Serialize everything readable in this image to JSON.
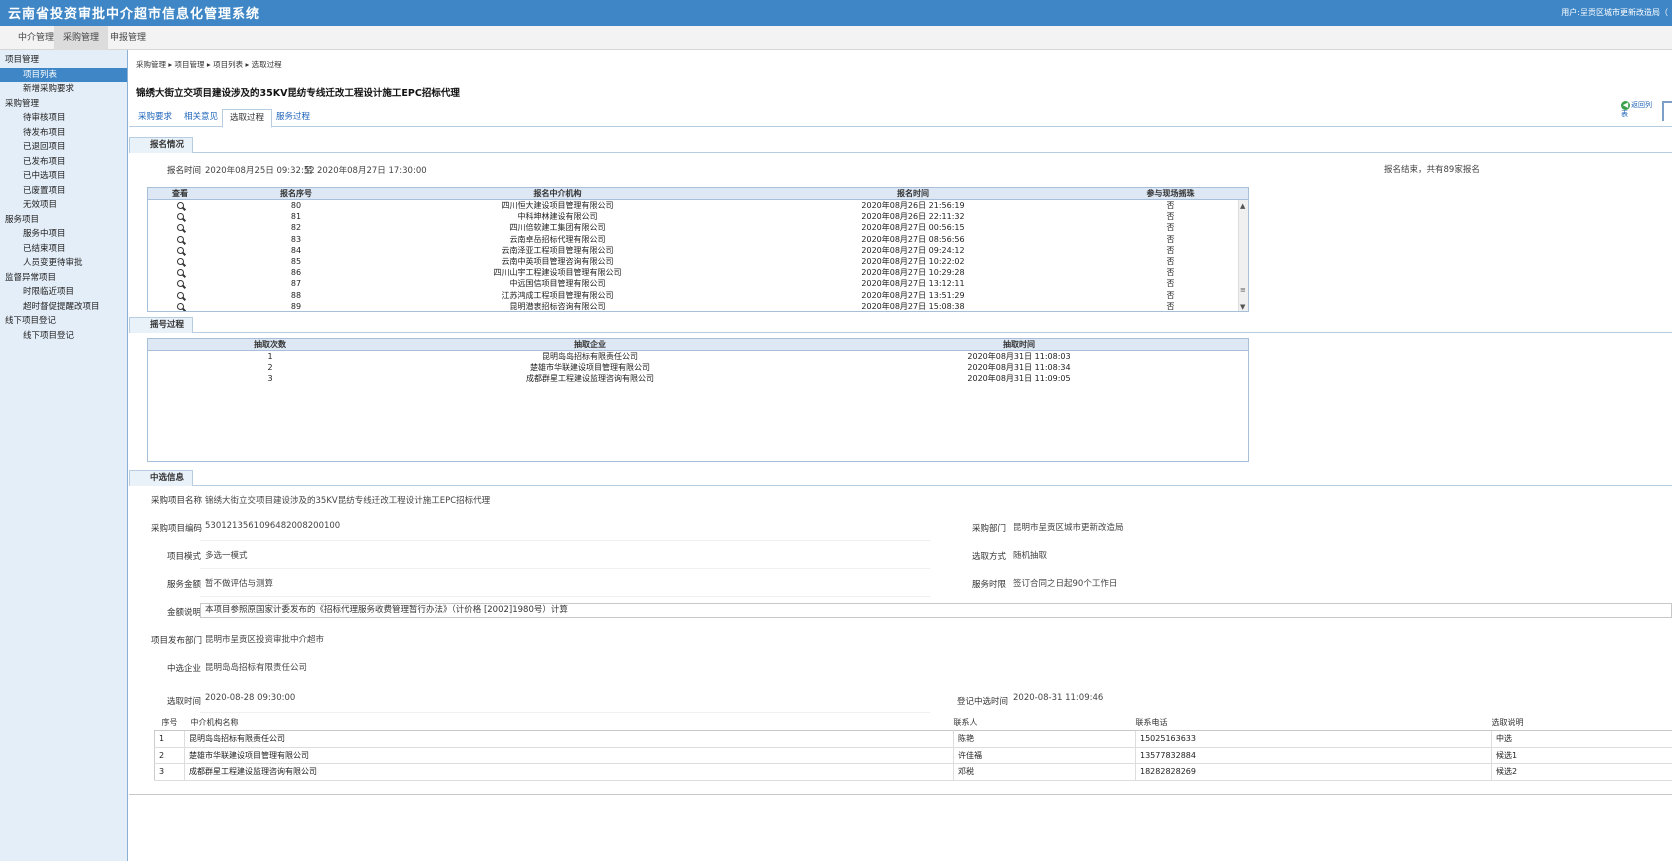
{
  "app": {
    "title": "云南省投资审批中介超市信息化管理系统",
    "user": "用户:呈贡区城市更新改造局（"
  },
  "nav_tabs": [
    {
      "label": "中介管理"
    },
    {
      "label": "采购管理"
    },
    {
      "label": "申报管理"
    }
  ],
  "sidebar": [
    {
      "label": "项目管理",
      "type": "group"
    },
    {
      "label": "项目列表",
      "type": "item",
      "active": true
    },
    {
      "label": "新增采购要求",
      "type": "item"
    },
    {
      "label": "采购管理",
      "type": "group"
    },
    {
      "label": "待审核项目",
      "type": "item"
    },
    {
      "label": "待发布项目",
      "type": "item"
    },
    {
      "label": "已退回项目",
      "type": "item"
    },
    {
      "label": "已发布项目",
      "type": "item"
    },
    {
      "label": "已中选项目",
      "type": "item"
    },
    {
      "label": "已废置项目",
      "type": "item"
    },
    {
      "label": "无效项目",
      "type": "item"
    },
    {
      "label": "服务项目",
      "type": "group"
    },
    {
      "label": "服务中项目",
      "type": "item"
    },
    {
      "label": "已结束项目",
      "type": "item"
    },
    {
      "label": "人员变更待审批",
      "type": "item"
    },
    {
      "label": "监督异常项目",
      "type": "group"
    },
    {
      "label": "时限临近项目",
      "type": "item"
    },
    {
      "label": "超时督促提醒改项目",
      "type": "item"
    },
    {
      "label": "线下项目登记",
      "type": "group"
    },
    {
      "label": "线下项目登记",
      "type": "item"
    }
  ],
  "breadcrumb": "采购管理 ▸ 项目管理 ▸ 项目列表 ▸ 选取过程",
  "page_title": "锦绣大街立交项目建设涉及的35KV昆纺专线迁改工程设计施工EPC招标代理",
  "back_label": "返回列表",
  "tabs": [
    {
      "label": "采购要求"
    },
    {
      "label": "相关意见"
    },
    {
      "label": "选取过程",
      "active": true
    },
    {
      "label": "服务过程"
    }
  ],
  "registration": {
    "section_title": "报名情况",
    "time_label": "报名时间",
    "start": "2020年08月25日 09:32:52",
    "to": "至",
    "end": "2020年08月27日 17:30:00",
    "summary": "报名结束，共有89家报名",
    "headers": [
      "查看",
      "报名序号",
      "报名中介机构",
      "报名时间",
      "参与现场摇珠"
    ],
    "rows": [
      {
        "no": "80",
        "org": "四川恒大建设项目管理有限公司",
        "time": "2020年08月26日 21:56:19",
        "join": "否"
      },
      {
        "no": "81",
        "org": "中科坤林建设有限公司",
        "time": "2020年08月26日 22:11:32",
        "join": "否"
      },
      {
        "no": "82",
        "org": "四川倍软建工集团有限公司",
        "time": "2020年08月27日 00:56:15",
        "join": "否"
      },
      {
        "no": "83",
        "org": "云南卓岳招标代理有限公司",
        "time": "2020年08月27日 08:56:56",
        "join": "否"
      },
      {
        "no": "84",
        "org": "云南泽亚工程项目管理有限公司",
        "time": "2020年08月27日 09:24:12",
        "join": "否"
      },
      {
        "no": "85",
        "org": "云南中英项目管理咨询有限公司",
        "time": "2020年08月27日 10:22:02",
        "join": "否"
      },
      {
        "no": "86",
        "org": "四川山宇工程建设项目管理有限公司",
        "time": "2020年08月27日 10:29:28",
        "join": "否"
      },
      {
        "no": "87",
        "org": "中远国信项目管理有限公司",
        "time": "2020年08月27日 13:12:11",
        "join": "否"
      },
      {
        "no": "88",
        "org": "江苏鸿成工程项目管理有限公司",
        "time": "2020年08月27日 13:51:29",
        "join": "否"
      },
      {
        "no": "89",
        "org": "昆明潜衷招标咨询有限公司",
        "time": "2020年08月27日 15:08:38",
        "join": "否"
      }
    ]
  },
  "draw": {
    "section_title": "摇号过程",
    "headers": [
      "抽取次数",
      "抽取企业",
      "抽取时间"
    ],
    "rows": [
      {
        "n": "1",
        "org": "昆明岛岛招标有限责任公司",
        "time": "2020年08月31日 11:08:03"
      },
      {
        "n": "2",
        "org": "楚雄市华联建设项目管理有限公司",
        "time": "2020年08月31日 11:08:34"
      },
      {
        "n": "3",
        "org": "成都群星工程建设监理咨询有限公司",
        "time": "2020年08月31日 11:09:05"
      }
    ]
  },
  "selection": {
    "section_title": "中选信息",
    "project_name_label": "采购项目名称",
    "project_name": "锦绣大街立交项目建设涉及的35KV昆纺专线迁改工程设计施工EPC招标代理",
    "project_code_label": "采购项目编码",
    "project_code": "530121356109648200820010​0",
    "dept_label": "采购部门",
    "dept": "昆明市呈贡区城市更新改造局",
    "mode_label": "项目模式",
    "mode": "多选一模式",
    "method_label": "选取方式",
    "method": "随机抽取",
    "amount_label": "服务金额",
    "amount": "暂不做评估与测算",
    "duration_label": "服务时限",
    "duration": "签订合同之日起90个工作日",
    "note_label": "金额说明",
    "note": "本项目参照原国家计委发布的《招标代理服务收费管理暂行办法》（计价格 [2002]1980号）计算",
    "publish_dept_label": "项目发布部门",
    "publish_dept": "昆明市呈贡区投资审批中介超市",
    "winner_label": "中选企业",
    "winner": "昆明岛岛招标有限责任公司",
    "select_time_label": "选取时间",
    "select_time": "2020-08-28 09:30:00",
    "reg_time_label": "登记中选时间",
    "reg_time": "2020-08-31 11:09:46",
    "headers": [
      "序号",
      "中介机构名称",
      "联系人",
      "联系电话",
      "选取说明"
    ],
    "rows": [
      {
        "no": "1",
        "org": "昆明岛岛招标有限责任公司",
        "contact": "陈艳",
        "phone": "15025163633",
        "note": "中选"
      },
      {
        "no": "2",
        "org": "楚雄市华联建设项目管理有限公司",
        "contact": "许佳福",
        "phone": "13577832884",
        "note": "候选1"
      },
      {
        "no": "3",
        "org": "成都群星工程建设监理咨询有限公司",
        "contact": "邓税",
        "phone": "18282828269",
        "note": "候选2"
      }
    ]
  }
}
